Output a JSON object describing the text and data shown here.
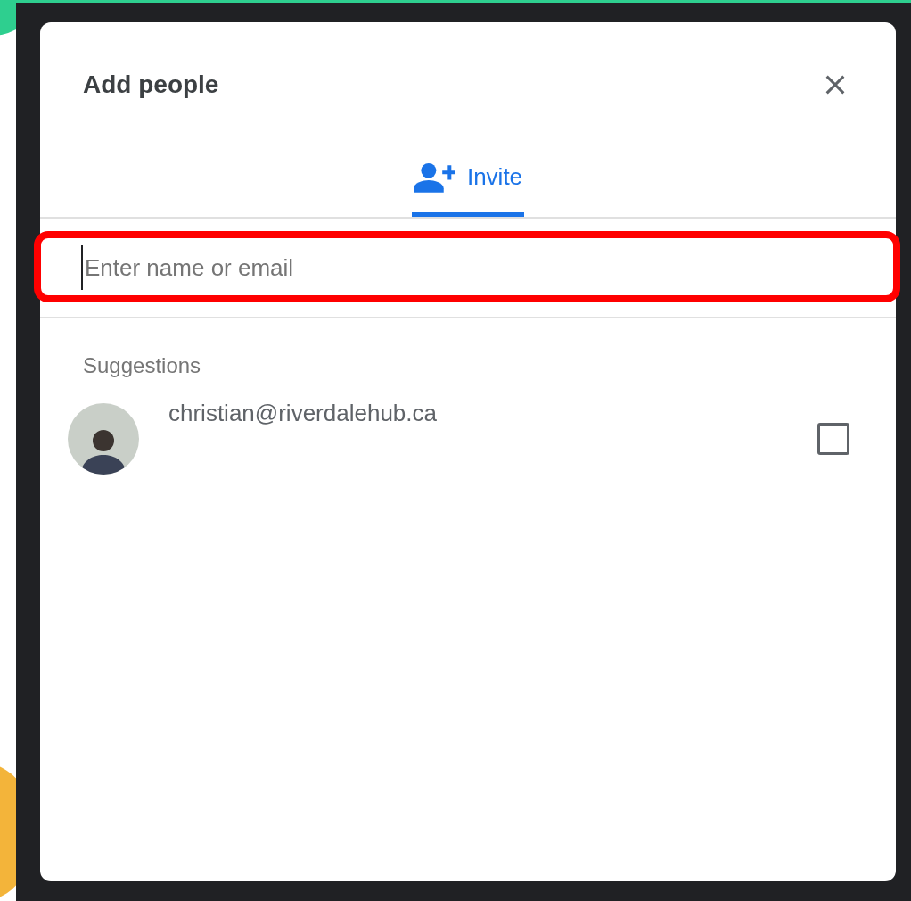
{
  "dialog": {
    "title": "Add people",
    "tabs": [
      {
        "label": "Invite",
        "selected": true
      }
    ],
    "search": {
      "placeholder": "Enter name or email",
      "highlighted": true
    },
    "suggestions_heading": "Suggestions",
    "suggestions": [
      {
        "email": "christian@riverdalehub.ca",
        "checked": false
      }
    ]
  }
}
